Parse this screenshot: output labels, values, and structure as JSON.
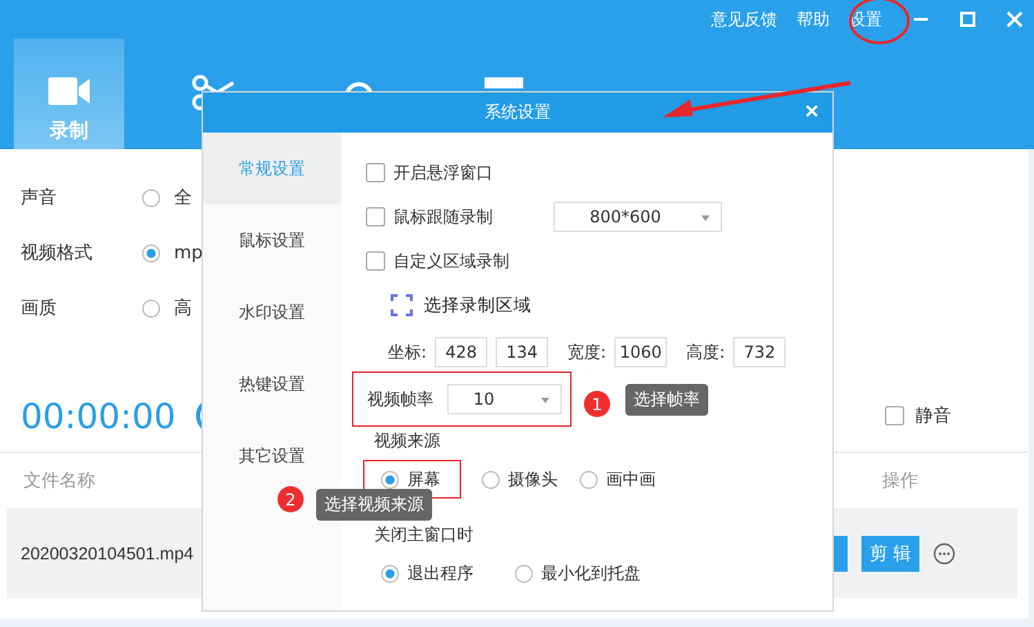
{
  "window": {
    "links": [
      "意见反馈",
      "帮助",
      "设置"
    ]
  },
  "main_tabs": [
    {
      "label": "录制",
      "selected": true
    },
    {
      "selected": false
    },
    {
      "selected": false
    },
    {
      "selected": false
    }
  ],
  "settings": [
    {
      "label": "声音",
      "option": "全",
      "selected": false
    },
    {
      "label": "视频格式",
      "option": "mp",
      "selected": true
    },
    {
      "label": "画质",
      "option": "高",
      "selected": false
    }
  ],
  "timer": "00:00:00",
  "audio": {
    "mute_label": "静音",
    "mute_checked": false
  },
  "file_table": {
    "columns": [
      "文件名称",
      "操作"
    ],
    "rows": [
      {
        "name": "20200320104501.mp4",
        "action": "剪 辑"
      }
    ]
  },
  "dialog": {
    "title": "系统设置",
    "close": "×",
    "tabs": [
      {
        "label": "常规设置",
        "selected": true
      },
      {
        "label": "鼠标设置",
        "selected": false
      },
      {
        "label": "水印设置",
        "selected": false
      },
      {
        "label": "热键设置",
        "selected": false
      },
      {
        "label": "其它设置",
        "selected": false
      }
    ],
    "options": [
      {
        "kind": "checkbox",
        "label": "开启悬浮窗口",
        "checked": false
      },
      {
        "kind": "checkbox",
        "label": "鼠标跟随录制",
        "checked": false,
        "select": "800*600"
      },
      {
        "kind": "checkbox",
        "label": "自定义区域录制",
        "checked": false
      },
      {
        "kind": "area",
        "label": "选择录制区域"
      },
      {
        "kind": "coords",
        "groups": [
          {
            "label": "坐标:",
            "values": [
              "428",
              "134"
            ]
          },
          {
            "label": "宽度:",
            "values": [
              "1060"
            ]
          },
          {
            "label": "高度:",
            "values": [
              "732"
            ]
          }
        ]
      },
      {
        "kind": "select",
        "label": "视频帧率",
        "value": "10",
        "highlighted": true
      },
      {
        "kind": "heading",
        "label": "视频来源"
      },
      {
        "kind": "radios",
        "options": [
          {
            "label": "屏幕",
            "selected": true,
            "highlighted": true
          },
          {
            "label": "摄像头",
            "selected": false,
            "highlighted": false
          },
          {
            "label": "画中画",
            "selected": false,
            "highlighted": false
          }
        ]
      },
      {
        "kind": "heading",
        "label": "关闭主窗口时"
      },
      {
        "kind": "radios",
        "options": [
          {
            "label": "退出程序",
            "selected": true,
            "highlighted": false
          },
          {
            "label": "最小化到托盘",
            "selected": false,
            "highlighted": false
          }
        ]
      }
    ]
  },
  "annotations": [
    {
      "number": "1",
      "text": "选择帧率"
    },
    {
      "number": "2",
      "text": "选择视频来源"
    }
  ]
}
